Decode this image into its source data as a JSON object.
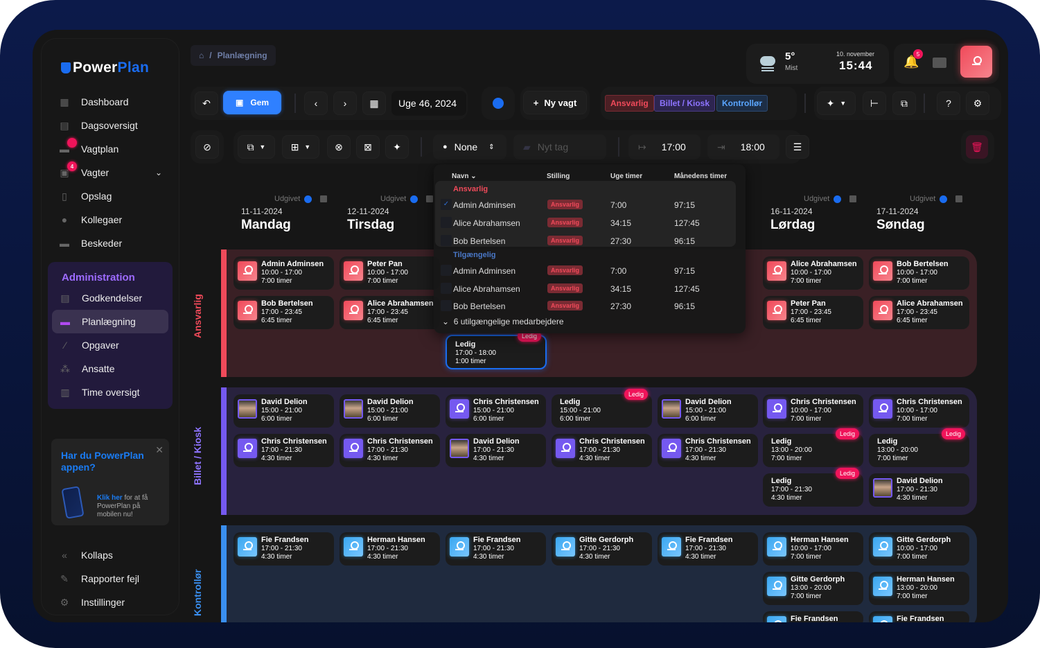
{
  "app": {
    "logo_left": "Power",
    "logo_right": "Plan"
  },
  "sidebar": {
    "items": [
      {
        "label": "Dashboard",
        "icon": "dashboard-icon"
      },
      {
        "label": "Dagsoversigt",
        "icon": "calendar-day-icon"
      },
      {
        "label": "Vagtplan",
        "icon": "calendar-icon",
        "dot": ""
      },
      {
        "label": "Vagter",
        "icon": "shifts-icon",
        "badge": "4"
      },
      {
        "label": "Opslag",
        "icon": "clipboard-icon"
      },
      {
        "label": "Kollegaer",
        "icon": "user-icon"
      },
      {
        "label": "Beskeder",
        "icon": "chat-icon"
      }
    ],
    "admin_title": "Administration",
    "admin_items": [
      {
        "label": "Godkendelser",
        "icon": "approval-icon"
      },
      {
        "label": "Planlægning",
        "icon": "calendar-icon",
        "active": true
      },
      {
        "label": "Opgaver",
        "icon": "tasks-icon"
      },
      {
        "label": "Ansatte",
        "icon": "group-icon"
      },
      {
        "label": "Time oversigt",
        "icon": "chart-icon"
      }
    ],
    "promo": {
      "title": "Har du PowerPlan appen?",
      "link": "Klik her",
      "text": " for at få PowerPlan på mobilen nu!"
    },
    "bottom": [
      {
        "label": "Kollaps",
        "icon": "collapse-icon"
      },
      {
        "label": "Rapporter fejl",
        "icon": "megaphone-icon"
      },
      {
        "label": "Instillinger",
        "icon": "gear-icon"
      }
    ]
  },
  "breadcrumb": {
    "separator": "/",
    "current": "Planlægning"
  },
  "weather": {
    "temp": "5°",
    "condition": "Mist",
    "date": "10. november",
    "time": "15:44"
  },
  "notifications": {
    "count": "5"
  },
  "toolbar": {
    "save": "Gem",
    "week": "Uge 46, 2024",
    "new_shift": "Ny vagt",
    "tags": [
      "Ansvarlig",
      "Billet / Kiosk",
      "Kontrollør"
    ],
    "person": "None",
    "tag_placeholder": "Nyt tag",
    "start": "17:00",
    "end": "18:00"
  },
  "days": [
    {
      "pub": "Udgivet",
      "date": "11-11-2024",
      "name": "Mandag"
    },
    {
      "pub": "Udgivet",
      "date": "12-11-2024",
      "name": "Tirsdag"
    },
    {
      "pub": "Udgivet",
      "date": "16-11-2024",
      "name": "Lørdag"
    },
    {
      "pub": "Udgivet",
      "date": "17-11-2024",
      "name": "Søndag"
    }
  ],
  "sections": [
    {
      "label": "Ansvarlig",
      "color": "#f04a5a"
    },
    {
      "label": "Billet / Kiosk",
      "color": "#7559f0"
    },
    {
      "label": "Kontrollør",
      "color": "#3a8ff0"
    }
  ],
  "shifts": {
    "ansvarlig": [
      {
        "c": 0,
        "r": 0,
        "name": "Admin Adminsen",
        "time": "10:00 - 17:00",
        "hours": "7:00 timer"
      },
      {
        "c": 0,
        "r": 1,
        "name": "Bob Bertelsen",
        "time": "17:00 - 23:45",
        "hours": "6:45 timer"
      },
      {
        "c": 1,
        "r": 0,
        "name": "Peter Pan",
        "time": "10:00 - 17:00",
        "hours": "7:00 timer"
      },
      {
        "c": 1,
        "r": 1,
        "name": "Alice Abrahamsen",
        "time": "17:00 - 23:45",
        "hours": "6:45 timer"
      },
      {
        "c": 5,
        "r": 0,
        "name": "Alice Abrahamsen",
        "time": "10:00 - 17:00",
        "hours": "7:00 timer"
      },
      {
        "c": 5,
        "r": 1,
        "name": "Peter Pan",
        "time": "17:00 - 23:45",
        "hours": "6:45 timer"
      },
      {
        "c": 6,
        "r": 0,
        "name": "Bob Bertelsen",
        "time": "10:00 - 17:00",
        "hours": "7:00 timer"
      },
      {
        "c": 6,
        "r": 1,
        "name": "Alice Abrahamsen",
        "time": "17:00 - 23:45",
        "hours": "6:45 timer"
      }
    ],
    "selected": {
      "name": "Ledig",
      "time": "17:00 - 18:00",
      "hours": "1:00 timer",
      "badge": "Ledig"
    },
    "billet": [
      {
        "c": 0,
        "r": 0,
        "name": "David Delion",
        "time": "15:00 - 21:00",
        "hours": "6:00 timer",
        "photo": true
      },
      {
        "c": 0,
        "r": 1,
        "name": "Chris Christensen",
        "time": "17:00 - 21:30",
        "hours": "4:30 timer"
      },
      {
        "c": 1,
        "r": 0,
        "name": "David Delion",
        "time": "15:00 - 21:00",
        "hours": "6:00 timer",
        "photo": true
      },
      {
        "c": 1,
        "r": 1,
        "name": "Chris Christensen",
        "time": "17:00 - 21:30",
        "hours": "4:30 timer"
      },
      {
        "c": 2,
        "r": 0,
        "name": "Chris Christensen",
        "time": "15:00 - 21:00",
        "hours": "6:00 timer"
      },
      {
        "c": 2,
        "r": 1,
        "name": "David Delion",
        "time": "17:00 - 21:30",
        "hours": "4:30 timer",
        "photo": true
      },
      {
        "c": 3,
        "r": 0,
        "name": "Ledig",
        "time": "15:00 - 21:00",
        "hours": "6:00 timer",
        "ledig": true
      },
      {
        "c": 3,
        "r": 1,
        "name": "Chris Christensen",
        "time": "17:00 - 21:30",
        "hours": "4:30 timer"
      },
      {
        "c": 4,
        "r": 0,
        "name": "David Delion",
        "time": "15:00 - 21:00",
        "hours": "6:00 timer",
        "photo": true
      },
      {
        "c": 4,
        "r": 1,
        "name": "Chris Christensen",
        "time": "17:00 - 21:30",
        "hours": "4:30 timer"
      },
      {
        "c": 5,
        "r": 0,
        "name": "Chris Christensen",
        "time": "10:00 - 17:00",
        "hours": "7:00 timer"
      },
      {
        "c": 5,
        "r": 1,
        "name": "Ledig",
        "time": "13:00 - 20:00",
        "hours": "7:00 timer",
        "ledig": true
      },
      {
        "c": 5,
        "r": 2,
        "name": "Ledig",
        "time": "17:00 - 21:30",
        "hours": "4:30 timer",
        "ledig": true
      },
      {
        "c": 6,
        "r": 0,
        "name": "Chris Christensen",
        "time": "10:00 - 17:00",
        "hours": "7:00 timer"
      },
      {
        "c": 6,
        "r": 1,
        "name": "Ledig",
        "time": "13:00 - 20:00",
        "hours": "7:00 timer",
        "ledig": true
      },
      {
        "c": 6,
        "r": 2,
        "name": "David Delion",
        "time": "17:00 - 21:30",
        "hours": "4:30 timer",
        "photo": true
      }
    ],
    "kontrollor": [
      {
        "c": 0,
        "r": 0,
        "name": "Fie Frandsen",
        "time": "17:00 - 21:30",
        "hours": "4:30 timer"
      },
      {
        "c": 1,
        "r": 0,
        "name": "Herman Hansen",
        "time": "17:00 - 21:30",
        "hours": "4:30 timer"
      },
      {
        "c": 2,
        "r": 0,
        "name": "Fie Frandsen",
        "time": "17:00 - 21:30",
        "hours": "4:30 timer"
      },
      {
        "c": 3,
        "r": 0,
        "name": "Gitte Gerdorph",
        "time": "17:00 - 21:30",
        "hours": "4:30 timer"
      },
      {
        "c": 4,
        "r": 0,
        "name": "Fie Frandsen",
        "time": "17:00 - 21:30",
        "hours": "4:30 timer"
      },
      {
        "c": 5,
        "r": 0,
        "name": "Herman Hansen",
        "time": "10:00 - 17:00",
        "hours": "7:00 timer"
      },
      {
        "c": 5,
        "r": 1,
        "name": "Gitte Gerdorph",
        "time": "13:00 - 20:00",
        "hours": "7:00 timer"
      },
      {
        "c": 5,
        "r": 2,
        "name": "Fie Frandsen",
        "time": "",
        "hours": ""
      },
      {
        "c": 6,
        "r": 0,
        "name": "Gitte Gerdorph",
        "time": "10:00 - 17:00",
        "hours": "7:00 timer"
      },
      {
        "c": 6,
        "r": 1,
        "name": "Herman Hansen",
        "time": "13:00 - 20:00",
        "hours": "7:00 timer"
      },
      {
        "c": 6,
        "r": 2,
        "name": "Fie Frandsen",
        "time": "",
        "hours": ""
      }
    ],
    "ledig_label": "Ledig"
  },
  "dropdown": {
    "headers": [
      "Navn",
      "Stilling",
      "Uge timer",
      "Månedens timer"
    ],
    "groups": [
      {
        "label": "Ansvarlig",
        "rows": [
          {
            "name": "Admin Adminsen",
            "role": "Ansvarlig",
            "week": "7:00",
            "month": "97:15",
            "checked": true
          },
          {
            "name": "Alice Abrahamsen",
            "role": "Ansvarlig",
            "week": "34:15",
            "month": "127:45"
          },
          {
            "name": "Bob Bertelsen",
            "role": "Ansvarlig",
            "week": "27:30",
            "month": "96:15"
          }
        ]
      },
      {
        "label": "Tilgængelig",
        "rows": [
          {
            "name": "Admin Adminsen",
            "role": "Ansvarlig",
            "week": "7:00",
            "month": "97:15"
          },
          {
            "name": "Alice Abrahamsen",
            "role": "Ansvarlig",
            "week": "34:15",
            "month": "127:45"
          },
          {
            "name": "Bob Bertelsen",
            "role": "Ansvarlig",
            "week": "27:30",
            "month": "96:15"
          }
        ]
      }
    ],
    "more": "6 utilgængelige medarbejdere"
  }
}
